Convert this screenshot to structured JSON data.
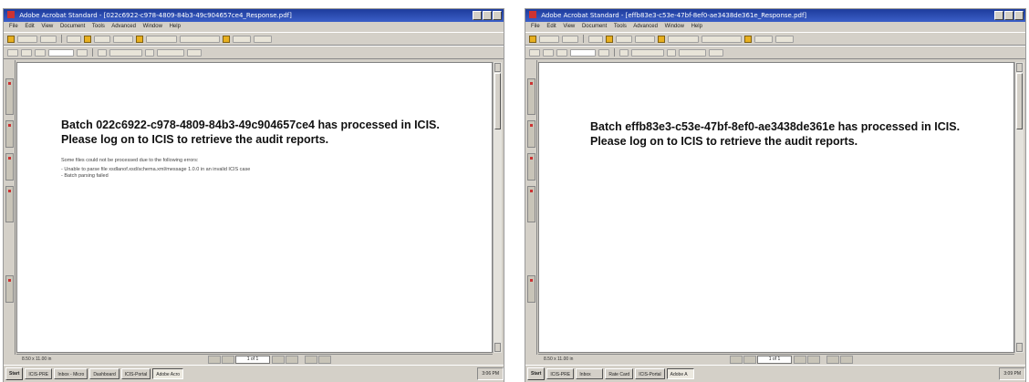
{
  "left": {
    "window_title": "Adobe Acrobat Standard - [022c6922-c978-4809-84b3-49c904657ce4_Response.pdf]",
    "menu": [
      "File",
      "Edit",
      "View",
      "Document",
      "Tools",
      "Advanced",
      "Window",
      "Help"
    ],
    "heading": "Batch 022c6922-c978-4809-84b3-49c904657ce4 has processed in ICIS. Please log on to ICIS to retrieve the audit reports.",
    "error_intro": "Some files could not be processed due to the following errors:",
    "errors": [
      "- Unable to parse file xsdlanof.xsd/schema.xml/message 1.0.0 in an invalid ICIS case",
      "- Batch parsing failed"
    ],
    "page_size": "8.50 x 11.00 in",
    "page_indicator": "1 of 1",
    "taskbar": {
      "start": "Start",
      "tasks": [
        "ICIS-PRE",
        "Inbox - Micro",
        "Dashboard",
        "ICIS-Portal",
        "Adobe Acro"
      ],
      "clock": "3:06 PM"
    }
  },
  "right": {
    "window_title": "Adobe Acrobat Standard - [effb83e3-c53e-47bf-8ef0-ae3438de361e_Response.pdf]",
    "menu": [
      "File",
      "Edit",
      "View",
      "Document",
      "Tools",
      "Advanced",
      "Window",
      "Help"
    ],
    "heading": "Batch effb83e3-c53e-47bf-8ef0-ae3438de361e has processed in ICIS. Please log on to ICIS to retrieve the audit reports.",
    "page_size": "8.50 x 11.00 in",
    "page_indicator": "1 of 1",
    "taskbar": {
      "start": "Start",
      "tasks": [
        "ICIS-PRE",
        "Inbox",
        "Rate Card",
        "ICIS-Portal",
        "Adobe A"
      ],
      "clock": "3:09 PM"
    }
  },
  "colors": {
    "titlebar": "#1e3c9c",
    "chrome": "#d4d0c8",
    "page": "#ffffff"
  }
}
